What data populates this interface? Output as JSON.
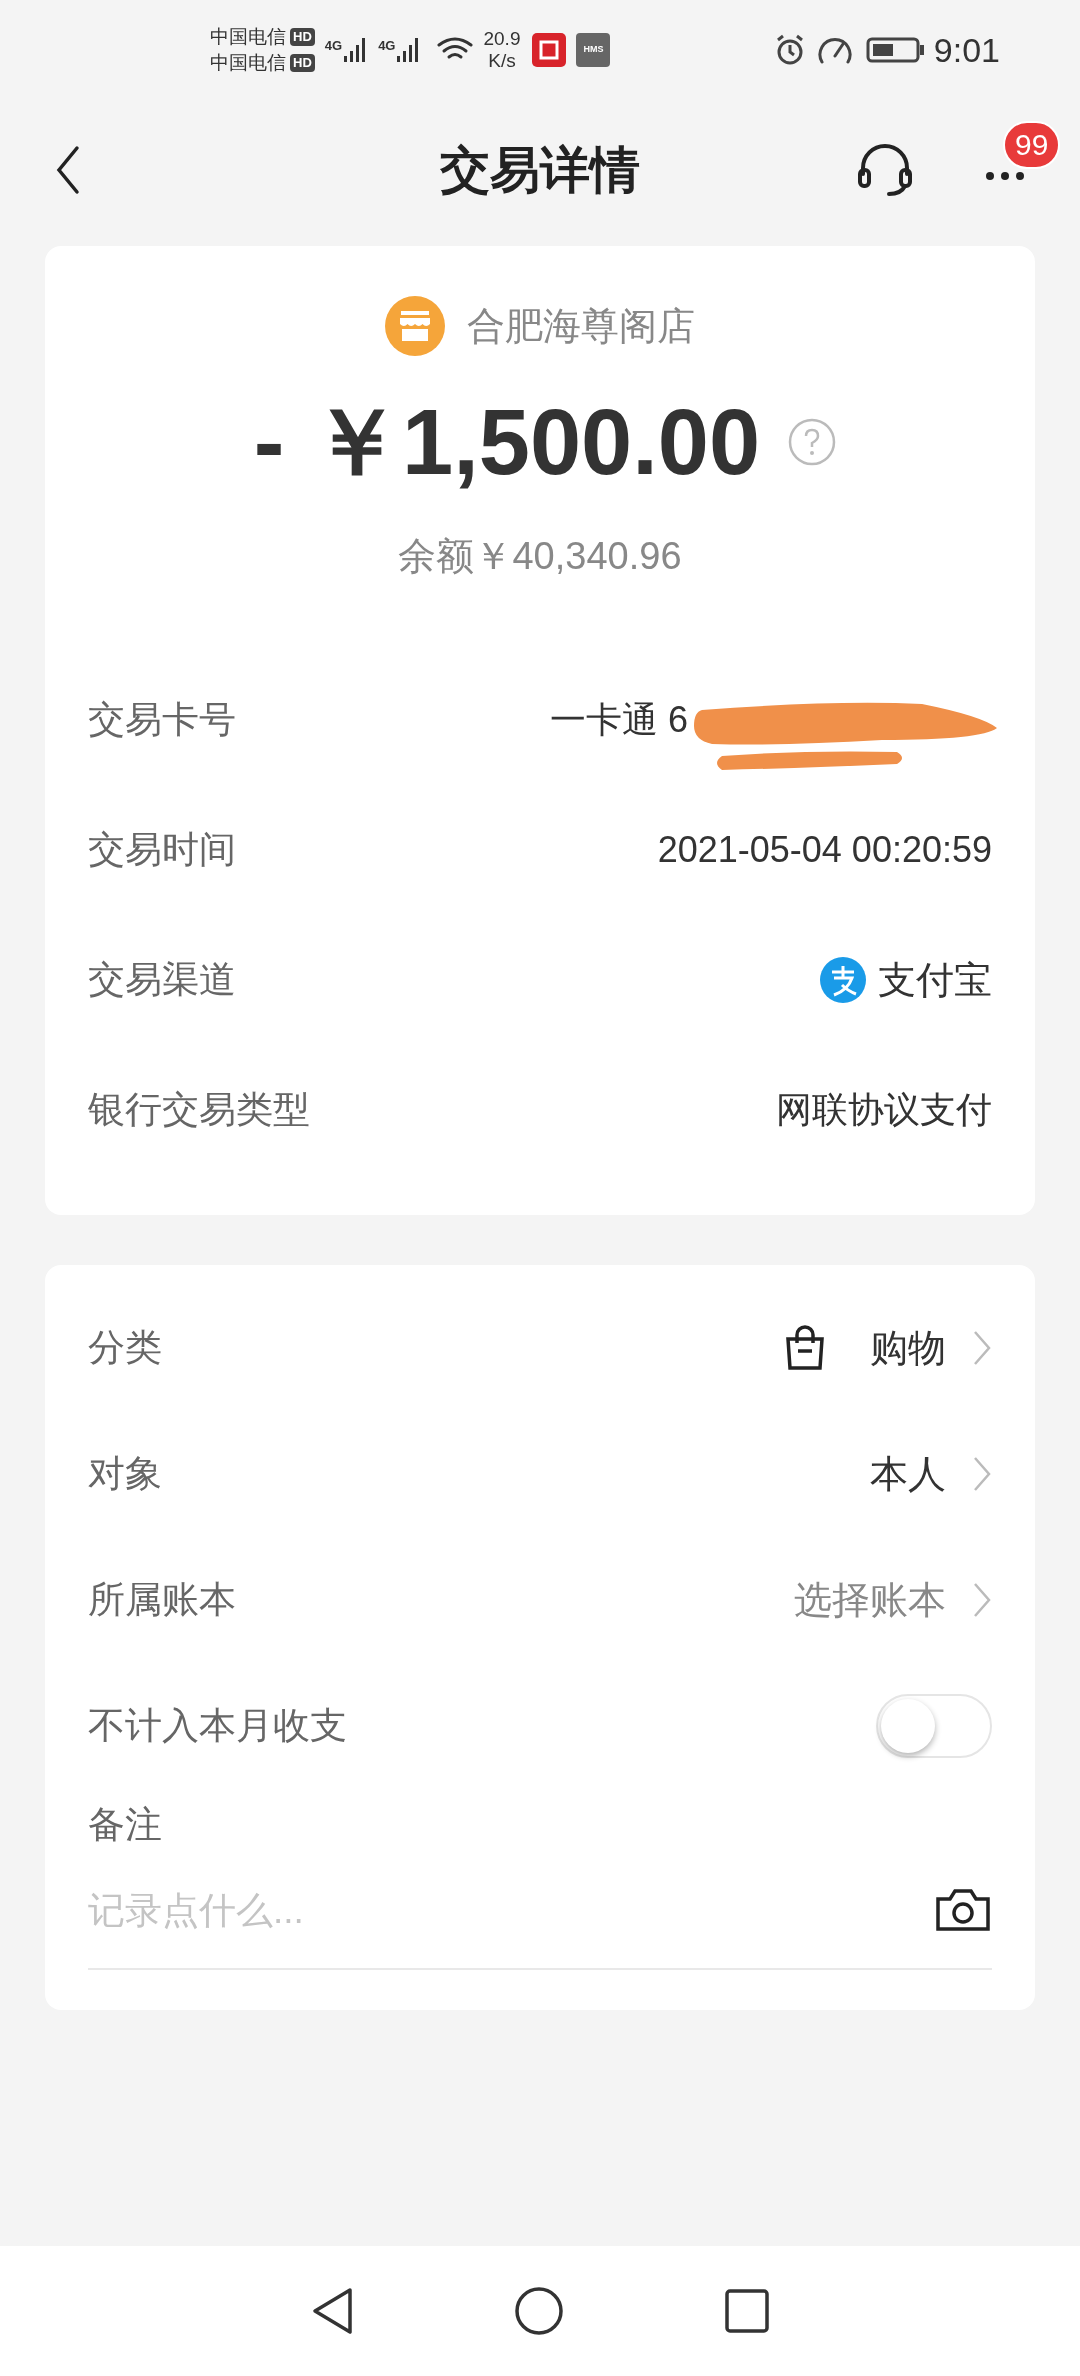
{
  "status_bar": {
    "carriers": [
      {
        "name": "中国电信",
        "badge": "HD"
      },
      {
        "name": "中国电信",
        "badge": "HD"
      }
    ],
    "networks": [
      "4G",
      "4G"
    ],
    "speed": [
      "20.9",
      "K/s"
    ],
    "app_badge": "HMS",
    "time": "9:01"
  },
  "header": {
    "title": "交易详情",
    "notification_count": "99"
  },
  "summary": {
    "merchant": "合肥海尊阁店",
    "amount": "- ￥1,500.00",
    "balance": "余额￥40,340.96"
  },
  "details": [
    {
      "kind": "card",
      "label": "交易卡号",
      "value": "一卡通 6"
    },
    {
      "kind": "text",
      "label": "交易时间",
      "value": "2021-05-04 00:20:59"
    },
    {
      "kind": "channel",
      "label": "交易渠道",
      "value": "支付宝"
    },
    {
      "kind": "text",
      "label": "银行交易类型",
      "value": "网联协议支付"
    }
  ],
  "settings": [
    {
      "kind": "category",
      "label": "分类",
      "value": "购物"
    },
    {
      "kind": "link",
      "label": "对象",
      "value": "本人",
      "muted": false
    },
    {
      "kind": "link",
      "label": "所属账本",
      "value": "选择账本",
      "muted": true
    },
    {
      "kind": "toggle",
      "label": "不计入本月收支",
      "on": false
    }
  ],
  "note": {
    "label": "备注",
    "placeholder": "记录点什么..."
  }
}
